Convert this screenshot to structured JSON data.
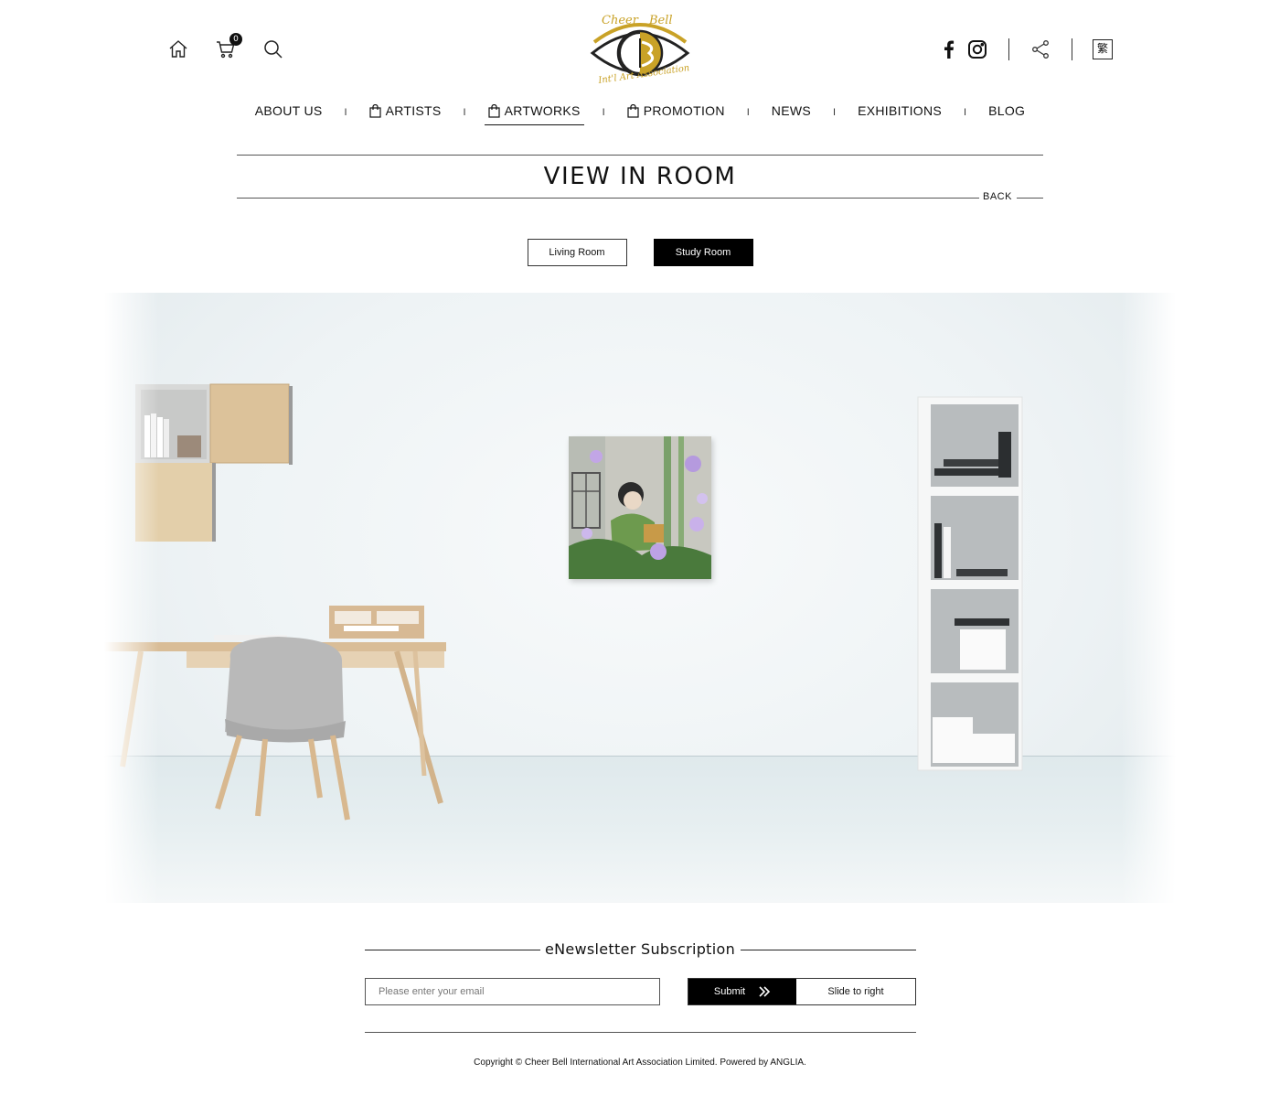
{
  "header": {
    "cart_count": "0",
    "logo_top_left": "Cheer",
    "logo_top_right": "Bell",
    "logo_bottom": "Int'l Art Association",
    "lang_label": "繁",
    "colors": {
      "logo_gold": "#c9a227",
      "text": "#111111"
    }
  },
  "nav": {
    "items": [
      {
        "label": "ABOUT US",
        "icon": null
      },
      {
        "label": "ARTISTS",
        "icon": "shopping-bag-icon"
      },
      {
        "label": "ARTWORKS",
        "icon": "shopping-bag-icon",
        "active": true
      },
      {
        "label": "PROMOTION",
        "icon": "shopping-bag-icon"
      },
      {
        "label": "NEWS",
        "icon": null
      },
      {
        "label": "EXHIBITIONS",
        "icon": null
      },
      {
        "label": "BLOG",
        "icon": null
      }
    ],
    "separator": "I"
  },
  "page": {
    "title": "VIEW IN ROOM",
    "back_label": "BACK"
  },
  "room_tabs": {
    "items": [
      "Living Room",
      "Study Room"
    ],
    "selected": "Study Room"
  },
  "newsletter": {
    "title": "eNewsletter Subscription",
    "email_placeholder": "Please enter your email",
    "submit_label": "Submit",
    "slide_label": "Slide to right"
  },
  "footer": {
    "copyright": "Copyright © Cheer Bell International Art Association Limited. Powered by ANGLIA."
  }
}
